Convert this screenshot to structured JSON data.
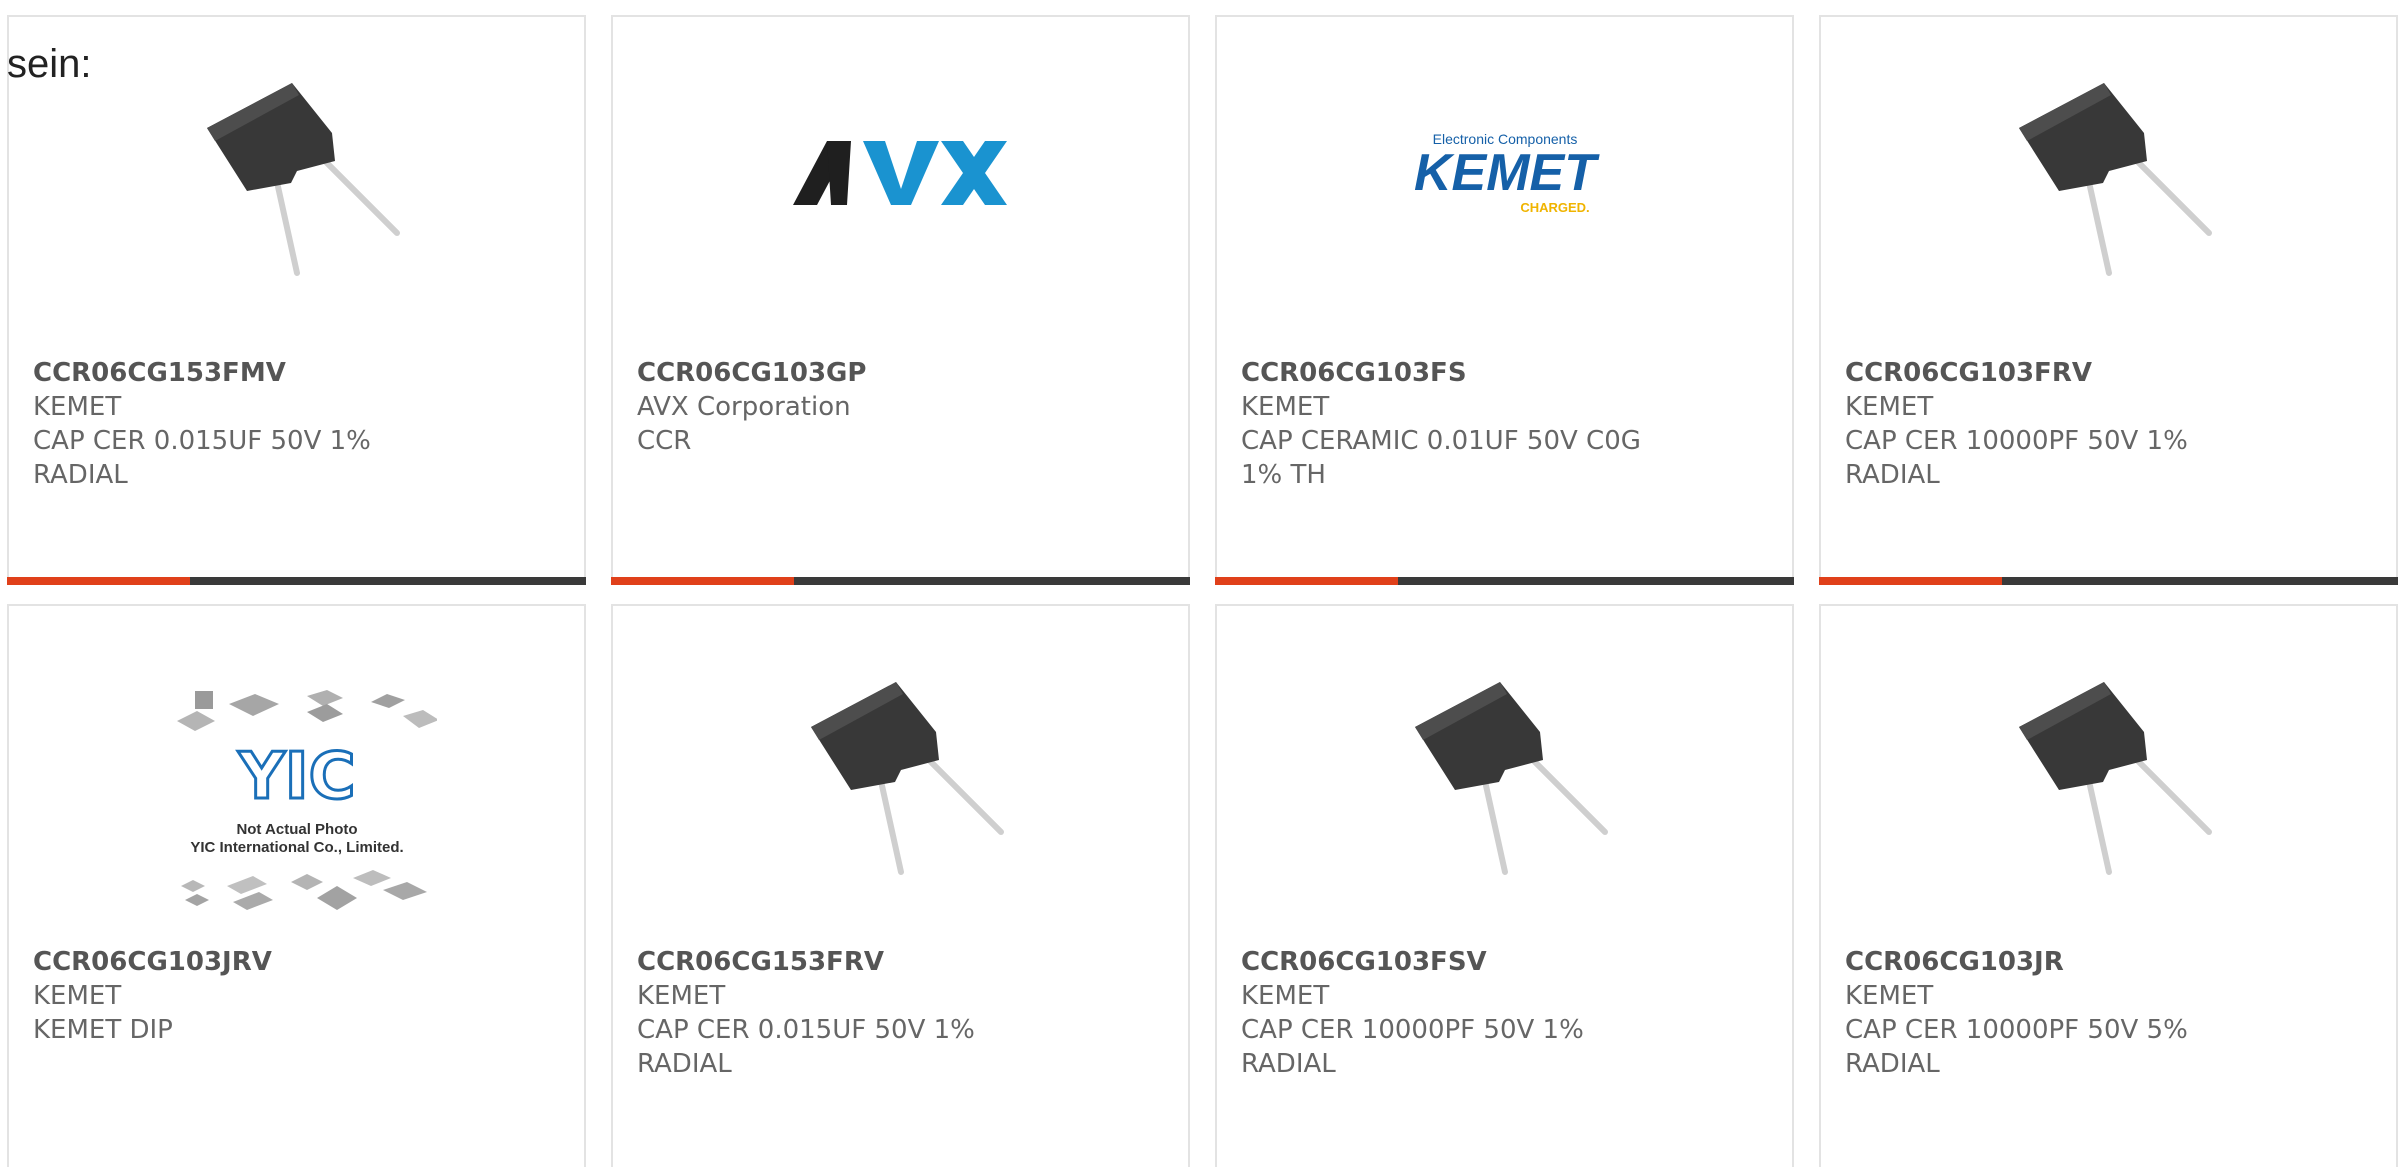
{
  "intro": {
    "text": "sein:"
  },
  "products": [
    {
      "part": "CCR06CG153FMV",
      "manufacturer": "KEMET",
      "desc1": "CAP CER 0.015UF 50V 1%",
      "desc2": "RADIAL",
      "image": "capacitor-image"
    },
    {
      "part": "CCR06CG103GP",
      "manufacturer": "AVX Corporation",
      "desc1": "CCR",
      "desc2": "",
      "image": "avx-logo"
    },
    {
      "part": "CCR06CG103FS",
      "manufacturer": "KEMET",
      "desc1": "CAP CERAMIC 0.01UF 50V C0G",
      "desc2": "1% TH",
      "image": "kemet-logo"
    },
    {
      "part": "CCR06CG103FRV",
      "manufacturer": "KEMET",
      "desc1": "CAP CER 10000PF 50V 1%",
      "desc2": "RADIAL",
      "image": "capacitor-image"
    },
    {
      "part": "CCR06CG103JRV",
      "manufacturer": "KEMET",
      "desc1": "KEMET DIP",
      "desc2": "",
      "image": "yic-placeholder"
    },
    {
      "part": "CCR06CG153FRV",
      "manufacturer": "KEMET",
      "desc1": "CAP CER 0.015UF 50V 1%",
      "desc2": "RADIAL",
      "image": "capacitor-image"
    },
    {
      "part": "CCR06CG103FSV",
      "manufacturer": "KEMET",
      "desc1": "CAP CER 10000PF 50V 1%",
      "desc2": "RADIAL",
      "image": "capacitor-image"
    },
    {
      "part": "CCR06CG103JR",
      "manufacturer": "KEMET",
      "desc1": "CAP CER 10000PF 50V 5%",
      "desc2": "RADIAL",
      "image": "capacitor-image"
    }
  ],
  "logos": {
    "avx": {
      "text": "AVX"
    },
    "kemet": {
      "top": "Electronic Components",
      "main": "KEMET",
      "sub": "CHARGED."
    },
    "yic": {
      "mark": "YIC",
      "line1": "Not Actual Photo",
      "line2": "YIC International Co., Limited."
    }
  },
  "colors": {
    "accent": "#e0401a",
    "bar": "#3a3a3a",
    "avx_blue": "#1a93d0",
    "kemet_blue": "#1560a8",
    "kemet_gold": "#f0b400"
  }
}
